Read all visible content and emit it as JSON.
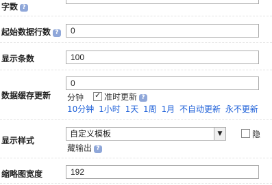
{
  "rows": {
    "word_count": {
      "label": "字数"
    },
    "start_row": {
      "label": "起始数据行数",
      "value": "0"
    },
    "display_count": {
      "label": "显示条数",
      "value": "100"
    },
    "cache_update": {
      "label": "数据缓存更新",
      "value": "0",
      "unit": "分钟",
      "timed_update_label": "准时更新",
      "timed_update_checked": true,
      "presets": [
        "10分钟",
        "1小时",
        "1天",
        "1周",
        "1月",
        "不自动更新",
        "永不更新"
      ]
    },
    "display_style": {
      "label": "显示样式",
      "selected": "自定义模板",
      "hide_output_label_a": "隐",
      "hide_output_label_b": "藏输出",
      "hide_output_checked": false
    },
    "thumb_width": {
      "label": "缩略图宽度",
      "value": "192"
    }
  },
  "icons": {
    "help": "help-icon",
    "dropdown": "chevron-down-icon"
  },
  "colors": {
    "link": "#1e60d8",
    "help_badge": "#8fa7d9"
  }
}
